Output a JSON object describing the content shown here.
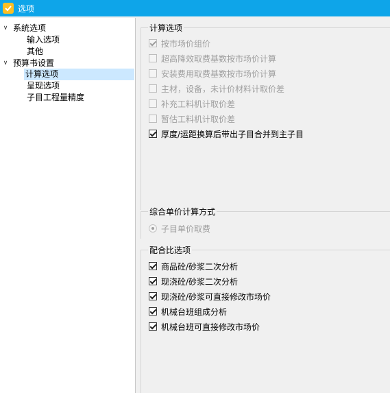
{
  "window": {
    "title": "选项"
  },
  "tree": {
    "items": [
      {
        "label": "系统选项",
        "expanded": true
      },
      {
        "label": "输入选项"
      },
      {
        "label": "其他"
      },
      {
        "label": "预算书设置",
        "expanded": true
      },
      {
        "label": "计算选项",
        "selected": true
      },
      {
        "label": "呈现选项"
      },
      {
        "label": "子目工程量精度"
      }
    ]
  },
  "calc": {
    "legend": "计算选项",
    "options": [
      {
        "label": "按市场价组价",
        "checked": true,
        "enabled": false
      },
      {
        "label": "超高降效取费基数按市场价计算",
        "checked": false,
        "enabled": false
      },
      {
        "label": "安装费用取费基数按市场价计算",
        "checked": false,
        "enabled": false
      },
      {
        "label": "主材，设备，未计价材料计取价差",
        "checked": false,
        "enabled": false
      },
      {
        "label": "补充工料机计取价差",
        "checked": false,
        "enabled": false
      },
      {
        "label": "暂估工料机计取价差",
        "checked": false,
        "enabled": false
      },
      {
        "label": "厚度/运距换算后带出子目合并到主子目",
        "checked": true,
        "enabled": true
      }
    ]
  },
  "unit_price": {
    "legend": "综合单价计算方式",
    "option": {
      "label": "子目单价取费",
      "checked": true,
      "enabled": false
    }
  },
  "mix": {
    "legend": "配合比选项",
    "options": [
      {
        "label": "商品砼/砂浆二次分析",
        "checked": true
      },
      {
        "label": "现浇砼/砂浆二次分析",
        "checked": true
      },
      {
        "label": "现浇砼/砂浆可直接修改市场价",
        "checked": true
      },
      {
        "label": "机械台班组成分析",
        "checked": true
      },
      {
        "label": "机械台班可直接修改市场价",
        "checked": true
      }
    ]
  }
}
